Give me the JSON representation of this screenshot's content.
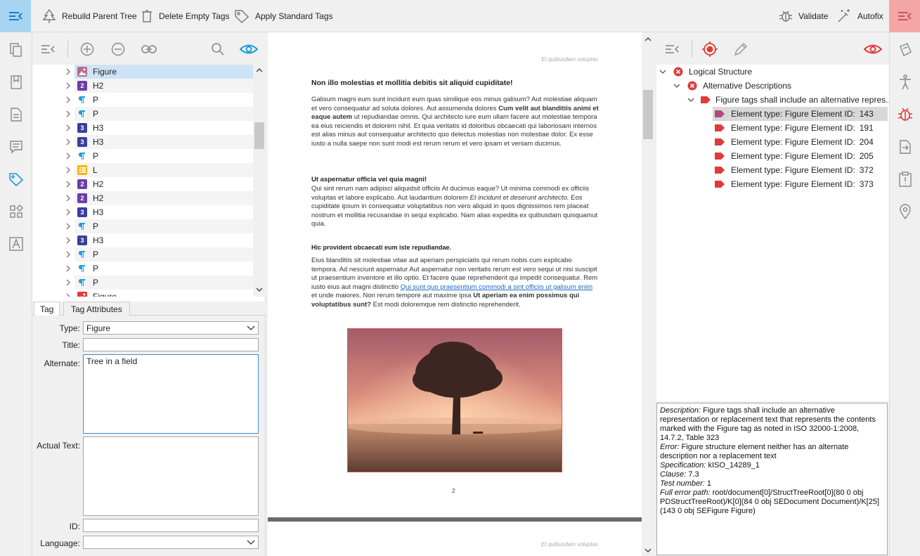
{
  "toolbar": {
    "rebuild": "Rebuild Parent Tree",
    "delete": "Delete Empty Tags",
    "apply": "Apply Standard Tags",
    "validate": "Validate",
    "autofix": "Autofix"
  },
  "tree": {
    "items": [
      {
        "type": "figure",
        "label": "Figure"
      },
      {
        "type": "h2",
        "label": "H2"
      },
      {
        "type": "p",
        "label": "P"
      },
      {
        "type": "p",
        "label": "P"
      },
      {
        "type": "h3",
        "label": "H3"
      },
      {
        "type": "h3",
        "label": "H3"
      },
      {
        "type": "p",
        "label": "P"
      },
      {
        "type": "l",
        "label": "L"
      },
      {
        "type": "h2",
        "label": "H2"
      },
      {
        "type": "h2",
        "label": "H2"
      },
      {
        "type": "h3",
        "label": "H3"
      },
      {
        "type": "p",
        "label": "P"
      },
      {
        "type": "h3",
        "label": "H3"
      },
      {
        "type": "p",
        "label": "P"
      },
      {
        "type": "p",
        "label": "P"
      },
      {
        "type": "p",
        "label": "P"
      },
      {
        "type": "figure-red",
        "label": "Figure"
      }
    ]
  },
  "tabs": {
    "tag": "Tag",
    "attrs": "Tag Attributes"
  },
  "form": {
    "type_label": "Type:",
    "type_value": "Figure",
    "title_label": "Title:",
    "alternate_label": "Alternate:",
    "alternate_value": "Tree in a field",
    "actual_label": "Actual Text:",
    "id_label": "ID:",
    "lang_label": "Language:"
  },
  "doc": {
    "running_header": "Et quibusdam voluptas",
    "h1": "Non illo molestias et mollitia debitis sit aliquid cupiditate!",
    "p1a": "Galisum magni eum sunt incidunt eum quas similique eos minus galisum? Aut molestiae aliquam et vero consequatur ad soluta dolores. Aut assumenda dolores ",
    "p1b": "Cum velit aut blanditiis animi et eaque autem",
    "p1c": " ut repudiandae omnis. Qui architecto iure eum ullam facere aut molestiae tempora ea eius reiciendis et dolorem nihil. Et quia veritatis id doloribus obcaecati qui laboriosam internos est alias minus aut consequatur architecto quo delectus molestias non molestiae dolor. Ex esse iusto a nulla saepe non sunt modi est rerum rerum et vero ipsam et veniam ducimus.",
    "h2": "Ut aspernatur officia vel quia magni!",
    "p2a": "Qui sint rerum nam adipisci aliquidsit officiis At ducimus eaque? Ut minima commodi ex officiis voluptas et labore explicabo. Aut laudantium dolorem ",
    "p2b": "Et incidunt et deserunt architecto.",
    "p2c": " Eos cupiditate ipsum in consequatur voluptatibus non vero aliquid in quos dignissimos rem placeat nostrum et mollitia recusandae in sequi explicabo. Nam alias expedita ex quibusdam quisquamut quia.",
    "h3": "Hic provident obcaecati eum iste repudiandae.",
    "p3a": "Eius blanditiis sit molestiae vitae aut aperiam perspiciatis qui rerum nobis cum explicabo tempora. Ad nesciunt aspernatur Aut aspernatur non veritatis rerum est vero sequi ut nisi suscipit ut praesentium inventore et illo optio. Et facere quae reprehenderit qui impedit consequatur. Rem iusto eius aut magni distinctio ",
    "p3link": "Qui sunt quo praesentium commodi a sint officiis ut galisum enim",
    "p3b": " et unde maiores. Non rerum tempore aut maxime ipsa ",
    "p3bold": "Ut aperiam ea enim possimus qui voluptatibus sunt?",
    "p3c": " Est modi doloremque rem distinctio reprehenderit.",
    "page_number": "2",
    "running_header2": "Et quibusdam voluptas"
  },
  "validation": {
    "root": "Logical Structure",
    "group": "Alternative Descriptions",
    "rule": "Figure tags shall include an alternative repres...",
    "elements": [
      {
        "label": "Element type: Figure Element ID:",
        "id": "143"
      },
      {
        "label": "Element type: Figure Element ID:",
        "id": "191"
      },
      {
        "label": "Element type: Figure Element ID:",
        "id": "204"
      },
      {
        "label": "Element type: Figure Element ID:",
        "id": "205"
      },
      {
        "label": "Element type: Figure Element ID:",
        "id": "372"
      },
      {
        "label": "Element type: Figure Element ID:",
        "id": "373"
      }
    ]
  },
  "details": {
    "desc_k": "Description:",
    "desc_v": " Figure tags shall include an alternative representation or replacement text that represents the contents marked with the Figure tag as noted in ISO 32000-1:2008, 14.7.2, Table 323",
    "err_k": "Error:",
    "err_v": " Figure structure element neither has an alternate description nor a replacement text",
    "spec_k": "Specification:",
    "spec_v": " kISO_14289_1",
    "clause_k": "Clause:",
    "clause_v": " 7.3",
    "test_k": "Test number:",
    "test_v": " 1",
    "path_k": "Full error path:",
    "path_v": " root/document[0]/StructTreeRoot[0](80 0 obj PDStructTreeRoot)/K[0](84 0 obj SEDocument Document)/K[25](143 0 obj SEFigure Figure)"
  },
  "colors": {
    "accent_blue": "#1a9bd7",
    "selected_corner_blue": "#a6d4f2",
    "corner_red": "#f4a6a6",
    "error_red": "#e03a3a",
    "h2_purple": "#6b3fa6",
    "h3_navy": "#3a3f9e",
    "p_blue": "#1ea0e0",
    "l_yellow": "#f5b800",
    "figure_mauve": "#b04a7a"
  }
}
